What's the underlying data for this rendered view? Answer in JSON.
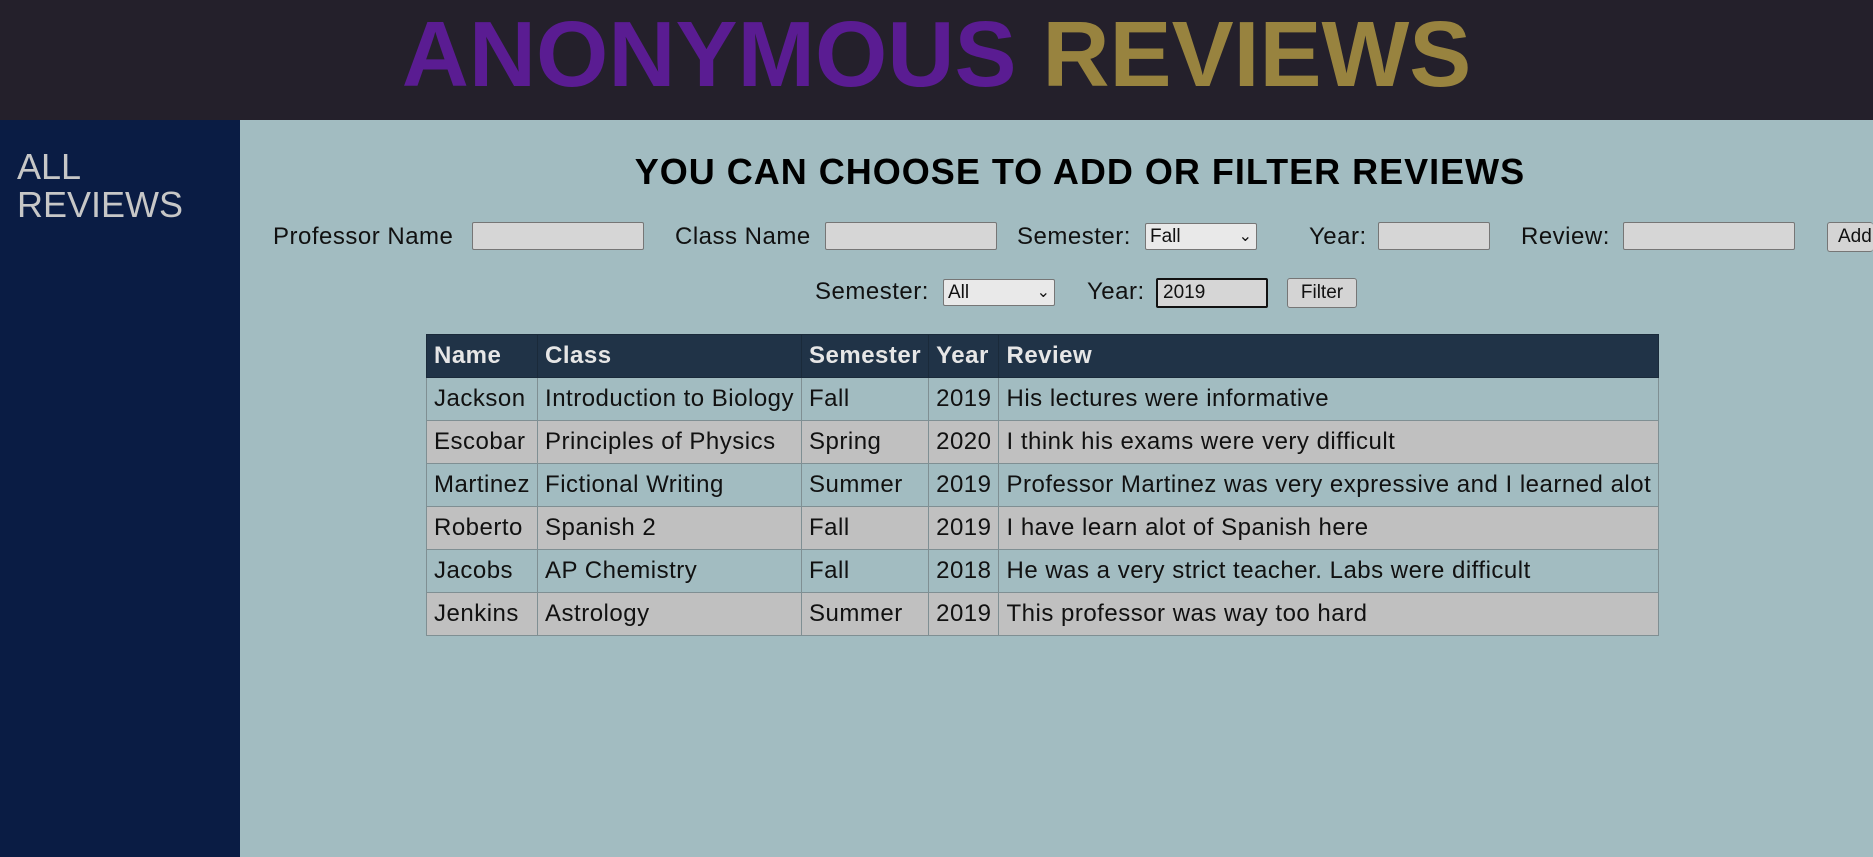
{
  "header": {
    "title_part1": "ANONYMOUS",
    "title_part2": "REVIEWS"
  },
  "sidebar": {
    "link_line1": "ALL",
    "link_line2": "REVIEWS"
  },
  "main": {
    "heading": "YOU CAN CHOOSE TO ADD OR FILTER REVIEWS",
    "add_form": {
      "professor_label": "Professor Name",
      "professor_value": "",
      "class_label": "Class Name",
      "class_value": "",
      "semester_label": "Semester:",
      "semester_selected": "Fall",
      "year_label": "Year:",
      "year_value": "",
      "review_label": "Review:",
      "review_value": "",
      "add_button": "Add"
    },
    "filter_form": {
      "semester_label": "Semester:",
      "semester_selected": "All",
      "year_label": "Year:",
      "year_value": "2019",
      "filter_button": "Filter"
    },
    "table": {
      "headers": [
        "Name",
        "Class",
        "Semester",
        "Year",
        "Review"
      ],
      "rows": [
        [
          "Jackson",
          "Introduction to Biology",
          "Fall",
          "2019",
          "His lectures were informative"
        ],
        [
          "Escobar",
          "Principles of Physics",
          "Spring",
          "2020",
          "I think his exams were very difficult"
        ],
        [
          "Martinez",
          "Fictional Writing",
          "Summer",
          "2019",
          "Professor Martinez was very expressive and I learned alot"
        ],
        [
          "Roberto",
          "Spanish 2",
          "Fall",
          "2019",
          "I have learn alot of Spanish here"
        ],
        [
          "Jacobs",
          "AP Chemistry",
          "Fall",
          "2018",
          "He was a very strict teacher. Labs were difficult"
        ],
        [
          "Jenkins",
          "Astrology",
          "Summer",
          "2019",
          "This professor was way too hard"
        ]
      ]
    }
  },
  "colors": {
    "banner_bg": "#24202b",
    "title_purple": "#5a1c92",
    "title_gold": "#98833f",
    "sidebar_bg": "#0a1c44",
    "main_bg": "#a2bcc1",
    "table_header_bg": "#203347",
    "row_alt_bg": "#c0c0c0"
  }
}
